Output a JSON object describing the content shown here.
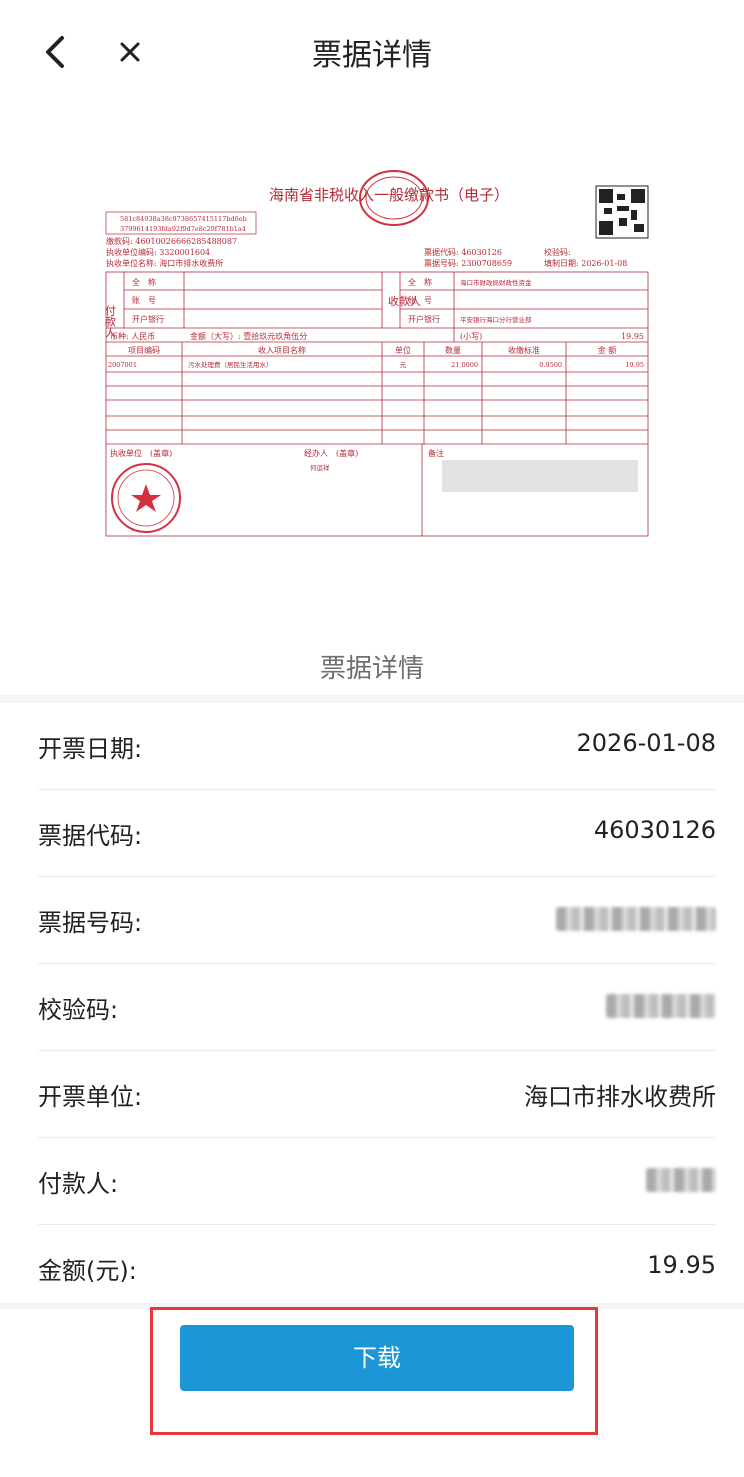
{
  "header": {
    "title": "票据详情",
    "back_icon": "chevron-left-icon",
    "close_icon": "close-icon"
  },
  "invoice": {
    "title": "海南省非税收入一般缴款书（电子）",
    "check_line1": "581c84938a38c9738657415117bd6eb",
    "check_line2": "3799614193fda92f9d7e8c29f781b1a4",
    "payment_code": "缴款码: 460100266662854880​87",
    "unit_code": "执收单位编码: 3320001604",
    "unit_name": "执收单位名称: 海口市排水收费所",
    "bill_code": "票据代码: 46030126",
    "bill_no": "票据号码: 2300708659",
    "check_code_label": "校验码:",
    "issue_date": "填制日期: 2026-01-08",
    "payer_label": "付款人",
    "payee_label": "收款人",
    "full_name": "全　称",
    "account": "账　号",
    "bank": "开户银行",
    "payee_name": "海口市财政局财政性资金",
    "payee_bank": "平安银行海口分行营业部",
    "currency": "币种: 人民币",
    "amount_upper": "金额（大写）: 壹拾玖元玖角伍分",
    "amount_small_label": "(小写)",
    "amount_small": "19.95",
    "col_code": "项目编码",
    "col_name": "收入项目名称",
    "col_unit": "单位",
    "col_qty": "数量",
    "col_std": "收缴标准",
    "col_amt": "金 额",
    "item_code": "2007001",
    "item_name": "污水处理费（居民生活用水）",
    "item_unit": "元",
    "item_qty": "21.0000",
    "item_std": "0.9500",
    "item_amt": "19.95",
    "seal_unit": "执收单位　(盖章)",
    "handler": "经办人　(盖章)",
    "handler_name": "何运祥",
    "remark": "备注"
  },
  "section_label": "票据详情",
  "details": [
    {
      "label": "开票日期:",
      "value": "2026-01-08"
    },
    {
      "label": "票据代码:",
      "value": "46030126"
    },
    {
      "label": "票据号码:",
      "value": ""
    },
    {
      "label": "校验码:",
      "value": ""
    },
    {
      "label": "开票单位:",
      "value": "海口市排水收费所"
    },
    {
      "label": "付款人:",
      "value": ""
    },
    {
      "label": "金额(元):",
      "value": "19.95"
    }
  ],
  "download_label": "下载",
  "colors": {
    "accent": "#1b97d7",
    "highlight": "#e8363d",
    "invoice_red": "#b52a36"
  }
}
